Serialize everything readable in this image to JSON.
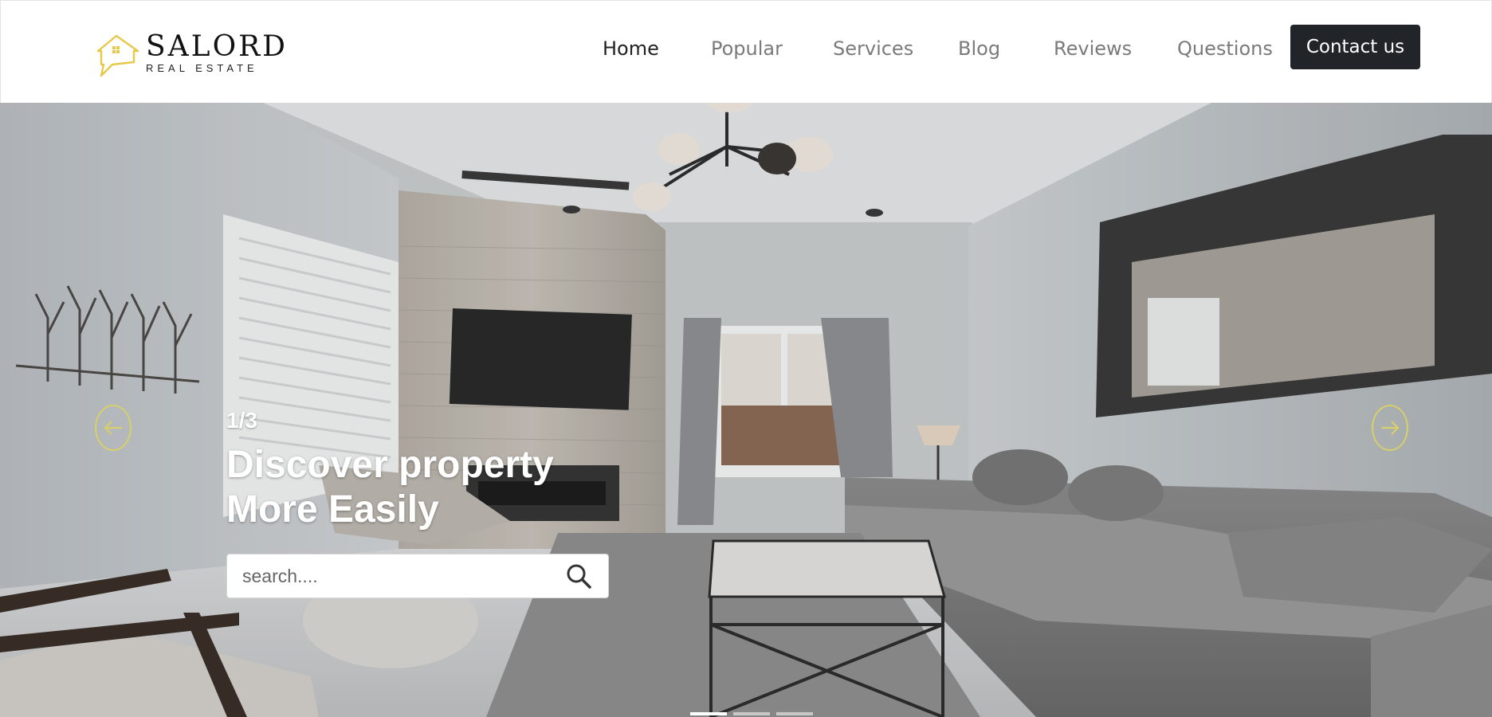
{
  "brand": {
    "name": "SALORD",
    "tagline": "REAL ESTATE",
    "accent_color": "#e6c84a"
  },
  "nav": {
    "items": [
      {
        "label": "Home",
        "active": true
      },
      {
        "label": "Popular",
        "active": false
      },
      {
        "label": "Services",
        "active": false
      },
      {
        "label": "Blog",
        "active": false
      },
      {
        "label": "Reviews",
        "active": false
      },
      {
        "label": "Questions",
        "active": false
      }
    ],
    "contact_label": "Contact us"
  },
  "hero": {
    "slide_counter": "1/3",
    "title_line1": "Discover property",
    "title_line2": "More Easily",
    "search_placeholder": "search....",
    "slides_total": 3,
    "slide_active": 1,
    "icons": {
      "prev": "arrow-left-icon",
      "next": "arrow-right-icon",
      "search": "search-icon"
    }
  }
}
